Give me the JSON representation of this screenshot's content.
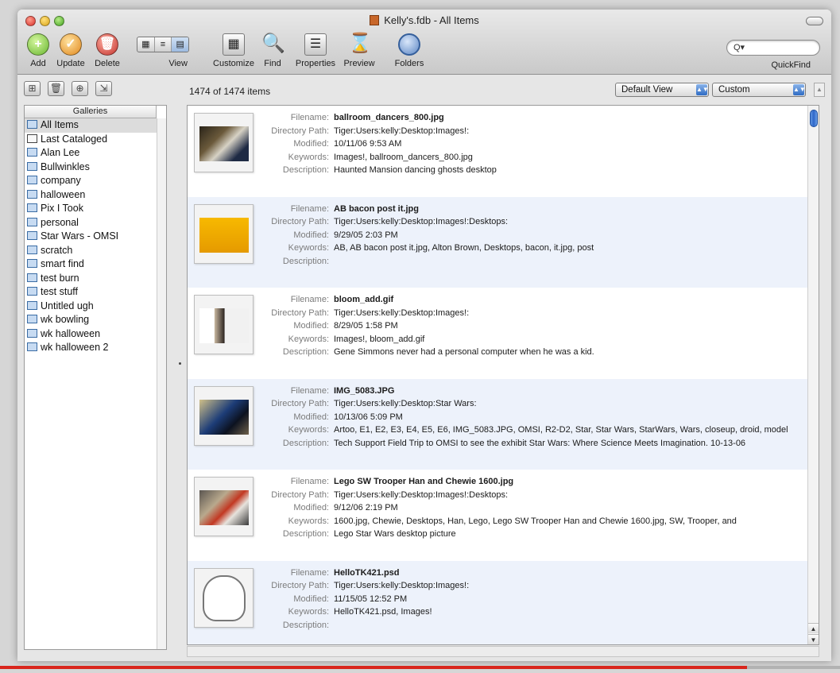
{
  "window": {
    "title": "Kelly's.fdb - All Items"
  },
  "toolbar": {
    "add_label": "Add",
    "update_label": "Update",
    "delete_label": "Delete",
    "view_label": "View",
    "customize_label": "Customize",
    "find_label": "Find",
    "properties_label": "Properties",
    "preview_label": "Preview",
    "folders_label": "Folders",
    "quickfind_label": "QuickFind",
    "quickfind_value": "Q▾"
  },
  "status": {
    "item_count": "1474 of 1474 items"
  },
  "view_popup": {
    "selected": "Default View"
  },
  "custom_popup": {
    "selected": "Custom"
  },
  "galleries": {
    "header": "Galleries",
    "items": [
      {
        "label": "All Items",
        "icon": "gallery-icon"
      },
      {
        "label": "Last Cataloged",
        "icon": "checkbox-gallery-icon"
      },
      {
        "label": "Alan Lee",
        "icon": "gallery-icon"
      },
      {
        "label": "Bullwinkles",
        "icon": "gallery-icon"
      },
      {
        "label": "company",
        "icon": "gallery-icon"
      },
      {
        "label": "halloween",
        "icon": "gallery-icon"
      },
      {
        "label": "Pix I Took",
        "icon": "gallery-icon"
      },
      {
        "label": "personal",
        "icon": "gallery-icon"
      },
      {
        "label": "Star Wars - OMSI",
        "icon": "gallery-icon"
      },
      {
        "label": "scratch",
        "icon": "gallery-icon"
      },
      {
        "label": "smart find",
        "icon": "gallery-icon"
      },
      {
        "label": "test burn",
        "icon": "gallery-icon"
      },
      {
        "label": "test stuff",
        "icon": "gallery-icon"
      },
      {
        "label": "Untitled ugh",
        "icon": "gallery-icon"
      },
      {
        "label": "wk bowling",
        "icon": "gallery-icon"
      },
      {
        "label": "wk halloween",
        "icon": "gallery-icon"
      },
      {
        "label": "wk halloween 2",
        "icon": "gallery-icon"
      }
    ]
  },
  "field_labels": {
    "filename": "Filename:",
    "directory": "Directory Path:",
    "modified": "Modified:",
    "keywords": "Keywords:",
    "description": "Description:"
  },
  "records": [
    {
      "filename": "ballroom_dancers_800.jpg",
      "directory": "Tiger:Users:kelly:Desktop:Images!:",
      "modified": "10/11/06 9:53 AM",
      "keywords": "Images!, ballroom_dancers_800.jpg",
      "description": "Haunted Mansion dancing ghosts desktop"
    },
    {
      "filename": "AB bacon post it.jpg",
      "directory": "Tiger:Users:kelly:Desktop:Images!:Desktops:",
      "modified": "9/29/05 2:03 PM",
      "keywords": "AB, AB bacon post it.jpg, Alton Brown, Desktops, bacon, it.jpg, post",
      "description": ""
    },
    {
      "filename": "bloom_add.gif",
      "directory": "Tiger:Users:kelly:Desktop:Images!:",
      "modified": "8/29/05 1:58 PM",
      "keywords": "Images!, bloom_add.gif",
      "description": "Gene Simmons never had a personal computer when he was a kid."
    },
    {
      "filename": "IMG_5083.JPG",
      "directory": "Tiger:Users:kelly:Desktop:Star Wars:",
      "modified": "10/13/06 5:09 PM",
      "keywords": "Artoo, E1, E2, E3, E4, E5, E6, IMG_5083.JPG, OMSI, R2-D2, Star, Star Wars, StarWars, Wars, closeup, droid, model",
      "description": "Tech Support Field Trip to OMSI to see the exhibit Star Wars: Where Science Meets Imagination. 10-13-06"
    },
    {
      "filename": "Lego SW Trooper Han and Chewie 1600.jpg",
      "directory": "Tiger:Users:kelly:Desktop:Images!:Desktops:",
      "modified": "9/12/06 2:19 PM",
      "keywords": "1600.jpg, Chewie, Desktops, Han, Lego, Lego SW Trooper Han and Chewie 1600.jpg, SW, Trooper, and",
      "description": "Lego Star Wars desktop picture"
    },
    {
      "filename": "HelloTK421.psd",
      "directory": "Tiger:Users:kelly:Desktop:Images!:",
      "modified": "11/15/05 12:52 PM",
      "keywords": "HelloTK421.psd, Images!",
      "description": ""
    }
  ]
}
